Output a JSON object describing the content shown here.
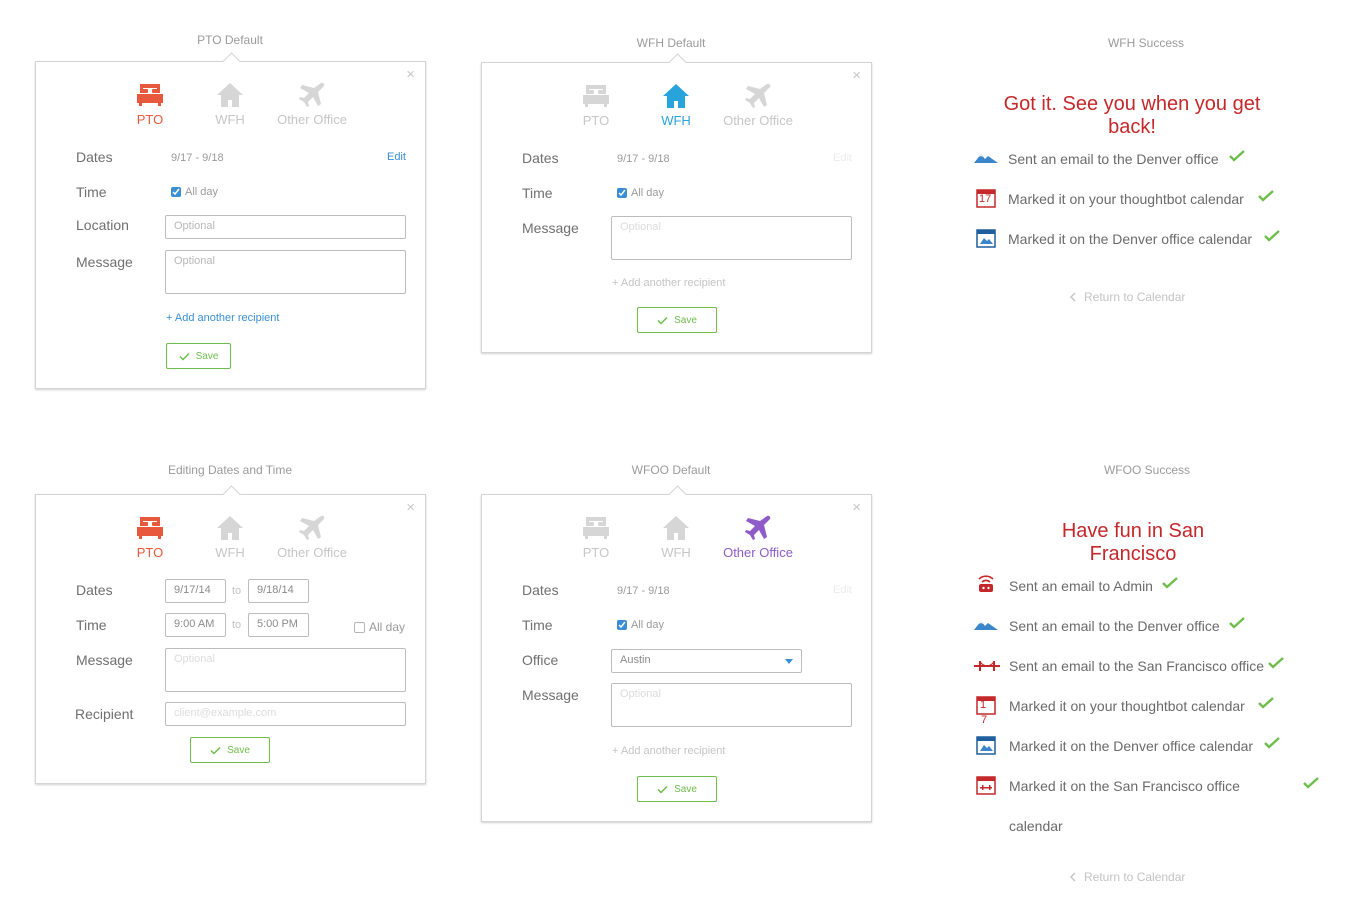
{
  "captions": {
    "pto_default": "PTO Default",
    "wfh_default": "WFH Default",
    "wfh_success": "WFH Success",
    "editing": "Editing Dates and Time",
    "wfoo_default": "WFOO Default",
    "wfoo_success": "WFOO Success"
  },
  "tabs": {
    "pto": "PTO",
    "wfh": "WFH",
    "other": "Other Office"
  },
  "labels": {
    "dates": "Dates",
    "time": "Time",
    "location": "Location",
    "message": "Message",
    "office": "Office",
    "recipient": "Recipient"
  },
  "common": {
    "close": "×",
    "date_range": "9/17 - 9/18",
    "edit": "Edit",
    "all_day": "All day",
    "optional": "Optional",
    "add_recipient": "+ Add another recipient",
    "save": "Save",
    "to": "to"
  },
  "editing": {
    "start_date": "9/17/14",
    "end_date": "9/18/14",
    "start_time": "9:00 AM",
    "end_time": "5:00 PM",
    "recipient_placeholder": "client@example.com"
  },
  "wfoo": {
    "office_value": "Austin"
  },
  "wfh_success": {
    "headline_1": "Got it. See you when you get",
    "headline_2": "back!",
    "rows": [
      "Sent an email to the Denver office",
      "Marked it on your thoughtbot calendar",
      "Marked it on the Denver office calendar"
    ],
    "calendar_day": "17",
    "return": "Return to Calendar"
  },
  "wfoo_success": {
    "headline_1": "Have fun in San",
    "headline_2": "Francisco",
    "rows": [
      "Sent an email to Admin",
      "Sent an email to the Denver office",
      "Sent an email to the San Francisco office",
      "Marked it on your thoughtbot calendar",
      "Marked it on the Denver office calendar",
      "Marked it on the San Francisco office",
      "calendar"
    ],
    "calendar_day_1": "1",
    "calendar_day_2": "7",
    "return": "Return to Calendar"
  },
  "colors": {
    "pto_active": "#e8583d",
    "wfh_active": "#29a3dc",
    "other_active": "#8d5cc9",
    "link": "#3a8fd4",
    "save_green": "#6ebd4b",
    "success_red": "#c4282a"
  },
  "icons": [
    "bed-icon",
    "house-icon",
    "plane-icon",
    "close-icon",
    "checkbox-icon",
    "checkmark-icon",
    "mountains-icon",
    "calendar-icon",
    "bridge-icon",
    "admin-icon",
    "chevron-left-icon"
  ]
}
